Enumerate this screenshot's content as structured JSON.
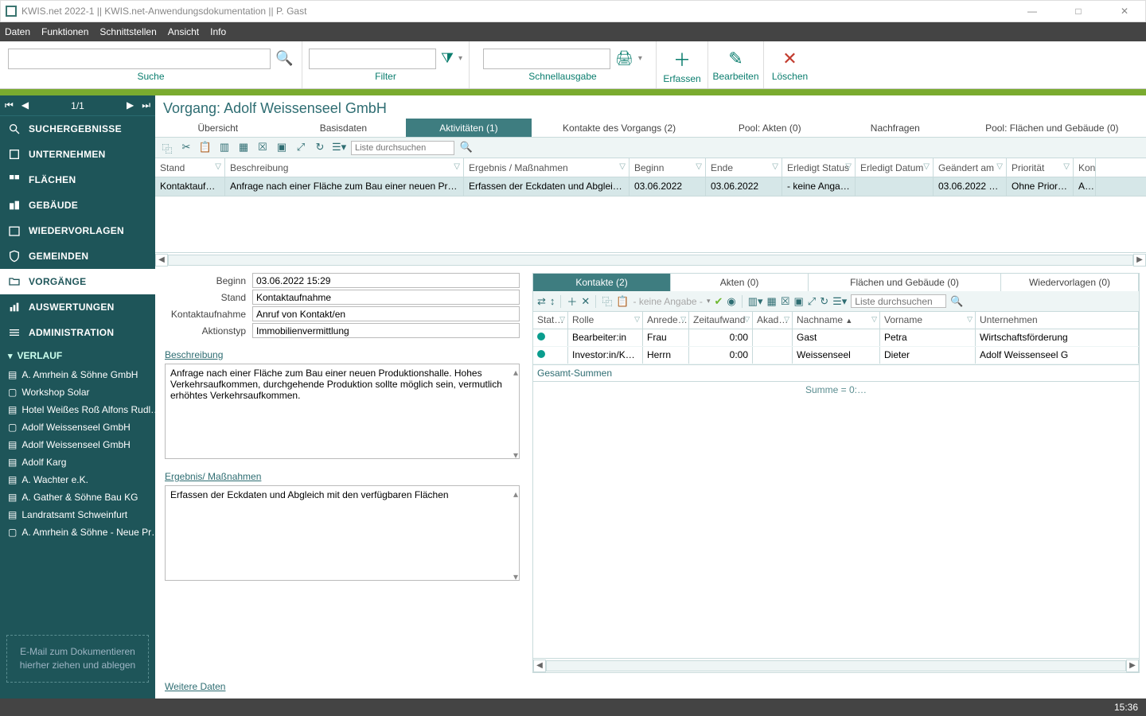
{
  "window": {
    "title": "KWIS.net 2022-1 || KWIS.net-Anwendungsdokumentation || P. Gast"
  },
  "menubar": [
    "Daten",
    "Funktionen",
    "Schnittstellen",
    "Ansicht",
    "Info"
  ],
  "toolrow": {
    "suche": {
      "label": "Suche"
    },
    "filter": {
      "label": "Filter"
    },
    "schnell": {
      "label": "Schnellausgabe"
    },
    "erfassen": "Erfassen",
    "bearbeiten": "Bearbeiten",
    "loeschen": "Löschen"
  },
  "pager": {
    "position": "1/1"
  },
  "nav": {
    "suchergebnisse": "SUCHERGEBNISSE",
    "unternehmen": "UNTERNEHMEN",
    "flaechen": "FLÄCHEN",
    "gebaeude": "GEBÄUDE",
    "wiedervorlagen": "WIEDERVORLAGEN",
    "gemeinden": "GEMEINDEN",
    "vorgaenge": "VORGÄNGE",
    "auswertungen": "AUSWERTUNGEN",
    "administration": "ADMINISTRATION"
  },
  "verlauf": {
    "header": "VERLAUF",
    "items": [
      "A. Amrhein & Söhne GmbH",
      "Workshop Solar",
      "Hotel Weißes Roß Alfons Rudl…",
      "Adolf Weissenseel GmbH",
      "Adolf Weissenseel GmbH",
      "Adolf Karg",
      "A. Wachter e.K.",
      "A. Gather & Söhne Bau KG",
      "Landratsamt Schweinfurt",
      "A. Amrhein & Söhne - Neue Pr…"
    ]
  },
  "dropzone": {
    "line1": "E-Mail  zum Dokumentieren",
    "line2": "hierher ziehen und ablegen"
  },
  "heading": "Vorgang: Adolf Weissenseel GmbH",
  "tabs": {
    "uebersicht": "Übersicht",
    "basisdaten": "Basisdaten",
    "aktivitaeten": "Aktivitäten (1)",
    "kontakte": "Kontakte des Vorgangs (2)",
    "akten": "Pool: Akten (0)",
    "nachfragen": "Nachfragen",
    "flaechen": "Pool: Flächen und Gebäude (0)"
  },
  "grid": {
    "search_placeholder": "Liste durchsuchen",
    "headers": {
      "stand": "Stand",
      "beschreibung": "Beschreibung",
      "ergebnis": "Ergebnis / Maßnahmen",
      "beginn": "Beginn",
      "ende": "Ende",
      "erledigt_status": "Erledigt Status",
      "erledigt_datum": "Erledigt Datum",
      "geaendert": "Geändert am",
      "prioritaet": "Priorität",
      "kontakt": "Kontakt"
    },
    "row": {
      "stand": "Kontaktaufnah…",
      "beschreibung": "Anfrage nach einer Fläche zum Bau einer neuen Produkti…",
      "ergebnis": "Erfassen der Eckdaten und Abgleich mit…",
      "beginn": "03.06.2022",
      "ende": "03.06.2022",
      "erledigt_status": "- keine Angabe -",
      "erledigt_datum": "",
      "geaendert": "03.06.2022 15:34",
      "prioritaet": "Ohne Priorität",
      "kontakt": "An…"
    }
  },
  "form": {
    "beginn_label": "Beginn",
    "beginn": "03.06.2022 15:29",
    "stand_label": "Stand",
    "stand": "Kontaktaufnahme",
    "kontakt_label": "Kontaktaufnahme",
    "kontakt": "Anruf von Kontakt/en",
    "aktionstyp_label": "Aktionstyp",
    "aktionstyp": "Immobilienvermittlung",
    "beschreibung_label": "Beschreibung",
    "beschreibung": "Anfrage nach einer Fläche zum Bau einer neuen Produktionshalle. Hohes Verkehrsaufkommen, durchgehende Produktion sollte möglich sein, vermutlich erhöhtes Verkehrsaufkommen.",
    "ergebnis_label": "Ergebnis/ Maßnahmen",
    "ergebnis": "Erfassen der Eckdaten und Abgleich mit den verfügbaren Flächen",
    "weitere": "Weitere Daten"
  },
  "subtabs": {
    "kontakte": "Kontakte (2)",
    "akten": "Akten (0)",
    "flaechen": "Flächen und Gebäude (0)",
    "wv": "Wiedervorlagen (0)"
  },
  "ktoolbar": {
    "keine_angabe": "- keine Angabe -",
    "search_placeholder": "Liste durchsuchen"
  },
  "kgrid": {
    "headers": {
      "status": "Stat…",
      "rolle": "Rolle",
      "anrede": "Anrede…",
      "zeit": "Zeitaufwand",
      "akad": "Akad…",
      "nachname": "Nachname",
      "vorname": "Vorname",
      "unternehmen": "Unternehmen"
    },
    "rows": [
      {
        "rolle": "Bearbeiter:in",
        "anrede": "Frau",
        "zeit": "0:00",
        "nachname": "Gast",
        "vorname": "Petra",
        "unternehmen": "Wirtschaftsförderung"
      },
      {
        "rolle": "Investor:in/Käuf…",
        "anrede": "Herrn",
        "zeit": "0:00",
        "nachname": "Weissenseel",
        "vorname": "Dieter",
        "unternehmen": "Adolf Weissenseel G"
      }
    ],
    "sum_label": "Gesamt-Summen",
    "sum_value": "Summe = 0:…"
  },
  "status_time": "15:36"
}
